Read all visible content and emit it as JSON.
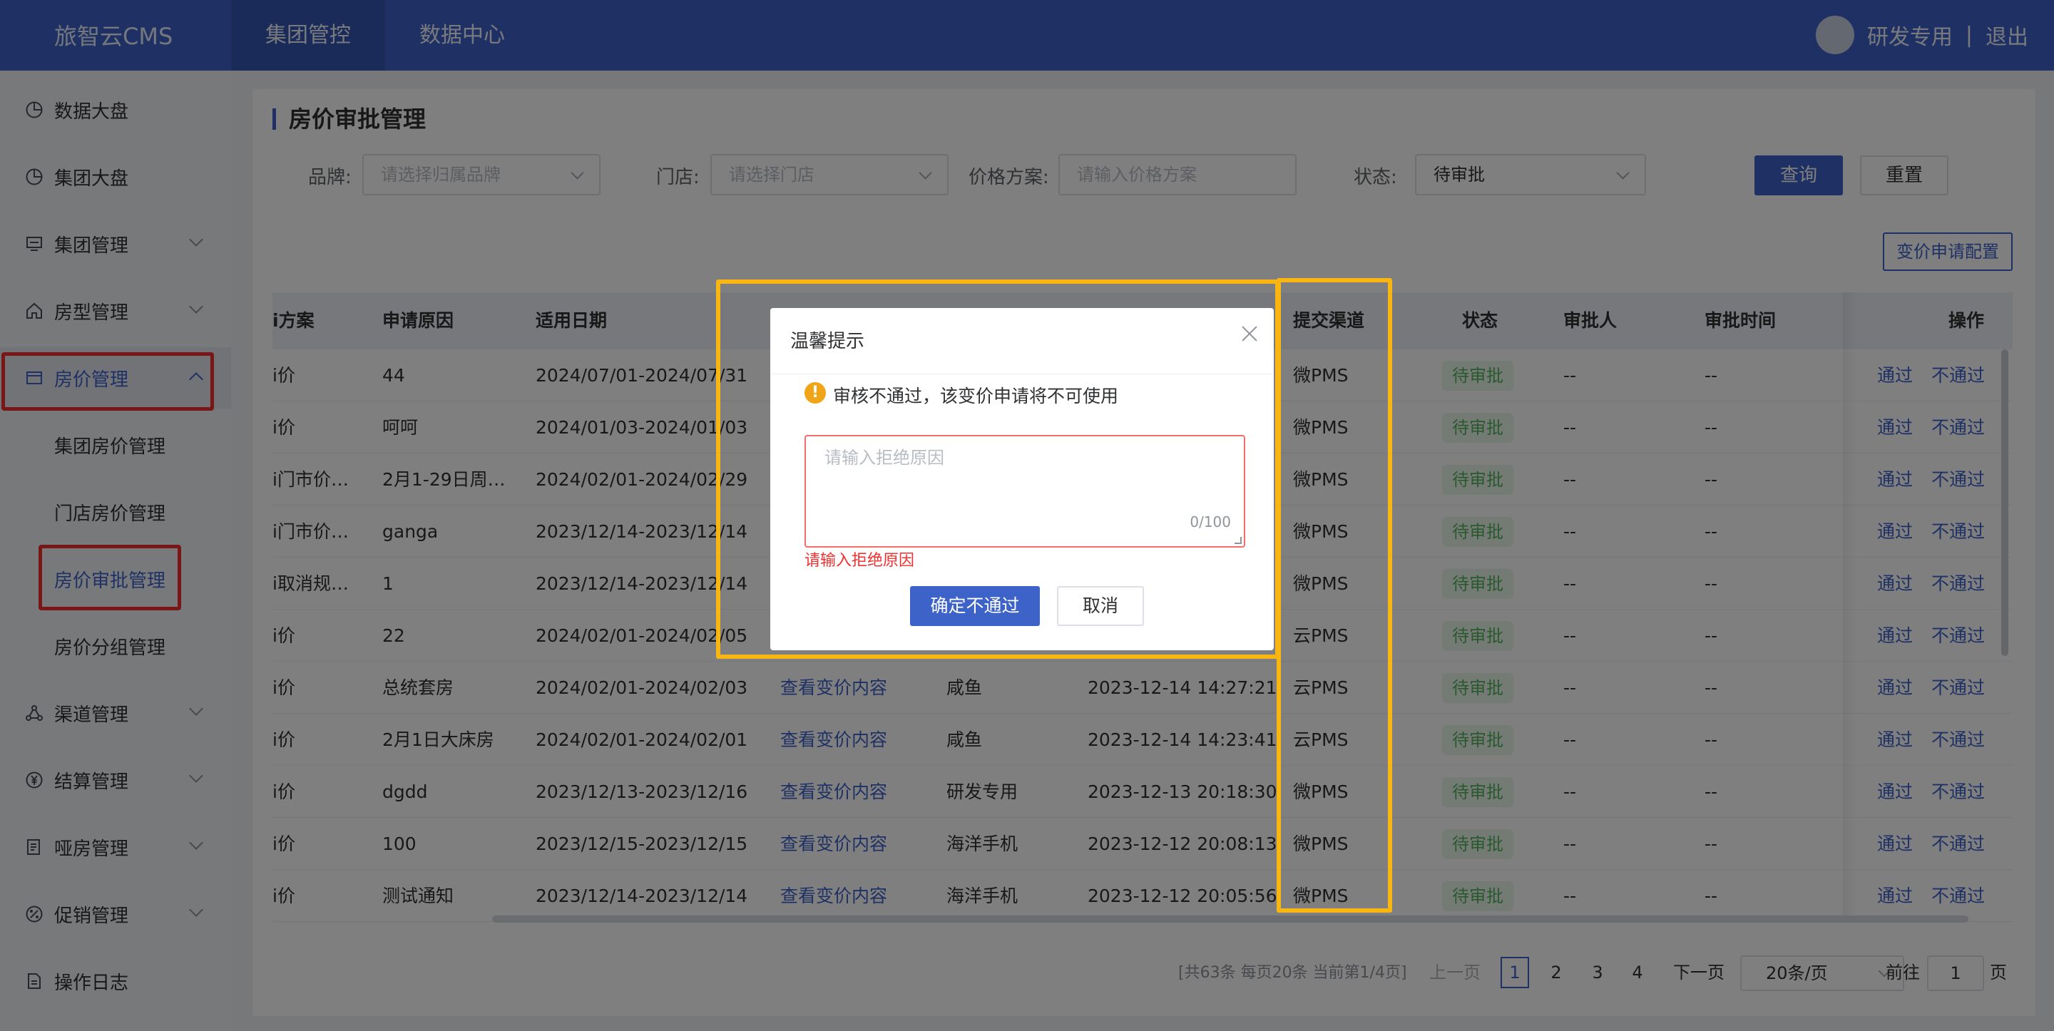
{
  "header": {
    "logo": "旅智云CMS",
    "tabs": [
      {
        "label": "集团管控",
        "active": true
      },
      {
        "label": "数据中心",
        "active": false
      }
    ],
    "user_name": "研发专用",
    "separator": "|",
    "logout": "退出"
  },
  "sidebar": {
    "items": [
      {
        "label": "数据大盘",
        "icon": "pie-chart-icon"
      },
      {
        "label": "集团大盘",
        "icon": "pie-chart-icon"
      },
      {
        "label": "集团管理",
        "icon": "monitor-icon"
      },
      {
        "label": "房型管理",
        "icon": "home-icon"
      },
      {
        "label": "房价管理",
        "icon": "card-icon"
      },
      {
        "label": "渠道管理",
        "icon": "channel-icon"
      },
      {
        "label": "结算管理",
        "icon": "yen-icon"
      },
      {
        "label": "哑房管理",
        "icon": "document-icon"
      },
      {
        "label": "促销管理",
        "icon": "promotion-icon"
      },
      {
        "label": "操作日志",
        "icon": "log-icon"
      }
    ],
    "sub_items": [
      "集团房价管理",
      "门店房价管理",
      "房价审批管理",
      "房价分组管理"
    ]
  },
  "page": {
    "title": "房价审批管理",
    "filters": {
      "brand_label": "品牌:",
      "brand_placeholder": "请选择归属品牌",
      "store_label": "门店:",
      "store_placeholder": "请选择门店",
      "plan_label": "价格方案:",
      "plan_placeholder": "请输入价格方案",
      "status_label": "状态:",
      "status_value": "待审批"
    },
    "search_button": "查询",
    "reset_button": "重置",
    "config_button": "变价申请配置"
  },
  "table": {
    "headers": {
      "plan": "i方案",
      "reason": "申请原因",
      "date": "适用日期",
      "channel": "提交渠道",
      "status": "状态",
      "approver": "审批人",
      "approve_time": "审批时间",
      "ops": "操作"
    },
    "rows": [
      {
        "plan": "i价",
        "reason": "44",
        "date": "2024/07/01-2024/07/31",
        "content": "",
        "applicant": "",
        "time": "",
        "channel": "微PMS",
        "status": "待审批",
        "approver": "--",
        "approve_time": "--"
      },
      {
        "plan": "i价",
        "reason": "呵呵",
        "date": "2024/01/03-2024/01/03",
        "content": "",
        "applicant": "",
        "time": "",
        "channel": "微PMS",
        "status": "待审批",
        "approver": "--",
        "approve_time": "--"
      },
      {
        "plan": "i门市价…",
        "reason": "2月1-29日周…",
        "date": "2024/02/01-2024/02/29",
        "content": "",
        "applicant": "",
        "time": "",
        "channel": "微PMS",
        "status": "待审批",
        "approver": "--",
        "approve_time": "--"
      },
      {
        "plan": "i门市价…",
        "reason": "ganga",
        "date": "2023/12/14-2023/12/14",
        "content": "",
        "applicant": "",
        "time": "",
        "channel": "微PMS",
        "status": "待审批",
        "approver": "--",
        "approve_time": "--"
      },
      {
        "plan": "i取消规…",
        "reason": "1",
        "date": "2023/12/14-2023/12/14",
        "content": "",
        "applicant": "",
        "time": "",
        "channel": "微PMS",
        "status": "待审批",
        "approver": "--",
        "approve_time": "--"
      },
      {
        "plan": "i价",
        "reason": "22",
        "date": "2024/02/01-2024/02/05",
        "content": "",
        "applicant": "",
        "time": "",
        "channel": "云PMS",
        "status": "待审批",
        "approver": "--",
        "approve_time": "--"
      },
      {
        "plan": "i价",
        "reason": "总统套房",
        "date": "2024/02/01-2024/02/03",
        "content": "查看变价内容",
        "applicant": "咸鱼",
        "time": "2023-12-14 14:27:21",
        "channel": "云PMS",
        "status": "待审批",
        "approver": "--",
        "approve_time": "--"
      },
      {
        "plan": "i价",
        "reason": "2月1日大床房",
        "date": "2024/02/01-2024/02/01",
        "content": "查看变价内容",
        "applicant": "咸鱼",
        "time": "2023-12-14 14:23:41",
        "channel": "云PMS",
        "status": "待审批",
        "approver": "--",
        "approve_time": "--"
      },
      {
        "plan": "i价",
        "reason": "dgdd",
        "date": "2023/12/13-2023/12/16",
        "content": "查看变价内容",
        "applicant": "研发专用",
        "time": "2023-12-13 20:18:30",
        "channel": "微PMS",
        "status": "待审批",
        "approver": "--",
        "approve_time": "--"
      },
      {
        "plan": "i价",
        "reason": "100",
        "date": "2023/12/15-2023/12/15",
        "content": "查看变价内容",
        "applicant": "海洋手机",
        "time": "2023-12-12 20:08:13",
        "channel": "微PMS",
        "status": "待审批",
        "approver": "--",
        "approve_time": "--"
      },
      {
        "plan": "i价",
        "reason": "测试通知",
        "date": "2023/12/14-2023/12/14",
        "content": "查看变价内容",
        "applicant": "海洋手机",
        "time": "2023-12-12 20:05:56",
        "channel": "微PMS",
        "status": "待审批",
        "approver": "--",
        "approve_time": "--"
      }
    ],
    "op_approve": "通过",
    "op_reject": "不通过"
  },
  "pagination": {
    "summary": "[共63条 每页20条 当前第1/4页]",
    "prev": "上一页",
    "pages": [
      "1",
      "2",
      "3",
      "4"
    ],
    "current_page": "1",
    "next": "下一页",
    "page_size": "20条/页",
    "goto_label": "前往",
    "goto_value": "1",
    "goto_suffix": "页"
  },
  "dialog": {
    "title": "温馨提示",
    "warning_icon": "!",
    "warning": "审核不通过，该变价申请将不可使用",
    "reason_placeholder": "请输入拒绝原因",
    "char_count": "0/100",
    "error": "请输入拒绝原因",
    "confirm": "确定不通过",
    "cancel": "取消"
  },
  "colors": {
    "primary": "#3e63c8",
    "annotation_red": "#f22f2f",
    "annotation_yellow": "#f9b613",
    "pending_tag": "#57b25f"
  }
}
